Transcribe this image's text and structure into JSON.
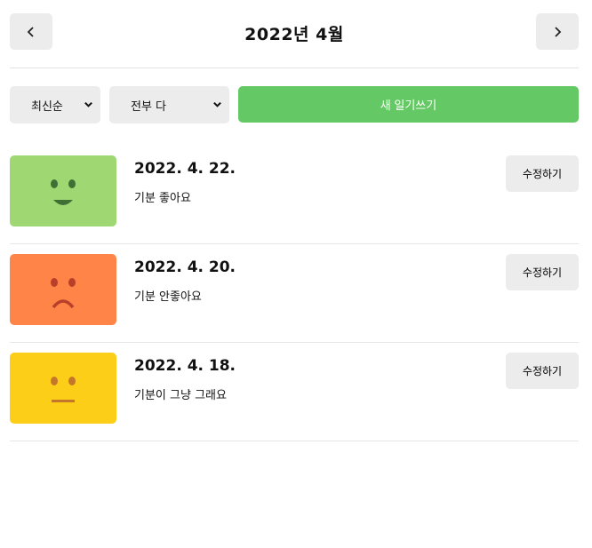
{
  "header": {
    "title": "2022년 4월",
    "prev_icon": "chevron-left-icon",
    "next_icon": "chevron-right-icon"
  },
  "menu": {
    "sort_selected": "최신순",
    "filter_selected": "전부 다",
    "new_label": "새 일기쓰기"
  },
  "colors": {
    "good": "#9fd872",
    "bad": "#ff8447",
    "soso": "#fdce17",
    "accent": "#64c964",
    "button_bg": "#ececec"
  },
  "diary": [
    {
      "date": "2022. 4. 22.",
      "content": "기분 좋아요",
      "emotion": "good",
      "edit_label": "수정하기"
    },
    {
      "date": "2022. 4. 20.",
      "content": "기분 안좋아요",
      "emotion": "bad",
      "edit_label": "수정하기"
    },
    {
      "date": "2022. 4. 18.",
      "content": "기분이 그냥 그래요",
      "emotion": "soso",
      "edit_label": "수정하기"
    }
  ]
}
